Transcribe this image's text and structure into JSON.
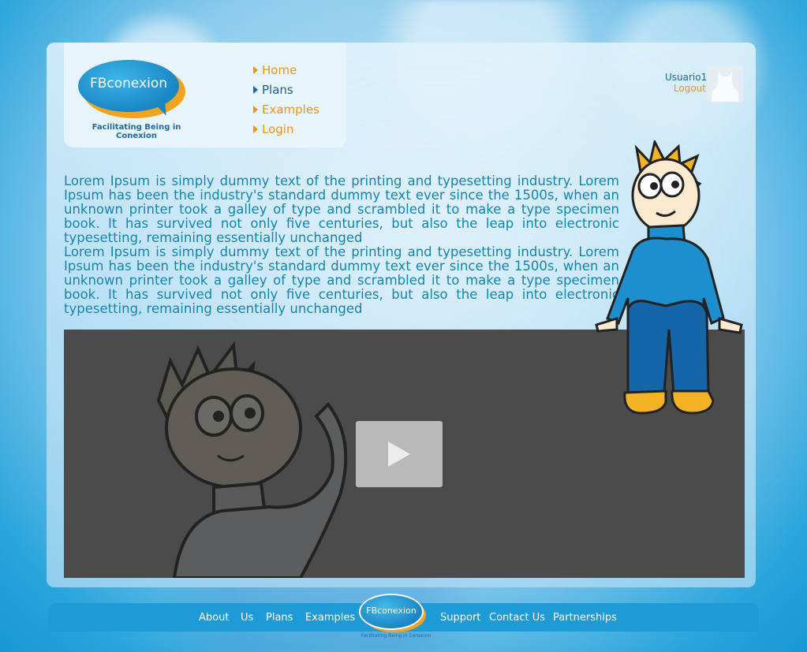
{
  "brand": {
    "name": "FBconexion",
    "tagline": "Facilitating Being in Conexion"
  },
  "nav": {
    "items": [
      {
        "label": "Home",
        "style": "orange"
      },
      {
        "label": "Plans",
        "style": "dark"
      },
      {
        "label": "Examples",
        "style": "orange"
      },
      {
        "label": "Login",
        "style": "orange"
      }
    ]
  },
  "user": {
    "name": "Usuario1",
    "logout": "Logout"
  },
  "content": {
    "paragraphs": [
      "Lorem Ipsum is simply dummy text of the printing and typesetting industry. Lorem Ipsum has been the industry's standard dummy text ever since the 1500s, when an unknown printer took a galley of type and scrambled it to make a type specimen book. It has survived not only five centuries, but also the leap into electronic typesetting, remaining essentially unchanged",
      "Lorem Ipsum is simply dummy text of the printing and typesetting industry. Lorem Ipsum has been the industry's standard dummy text ever since the 1500s, when an unknown printer took a galley of type and scrambled it to make a type specimen book. It has survived not only five centuries, but also the leap into electronic typesetting, remaining essentially unchanged"
    ]
  },
  "video": {
    "play_icon": "play-icon"
  },
  "footer": {
    "links": [
      "About",
      "Us",
      "Plans",
      "Examples",
      "Support",
      "Contact Us",
      "Partnerships"
    ],
    "logo_name": "FBconexion",
    "logo_tagline": "Facilitating Being in Conexion"
  },
  "colors": {
    "accent_orange": "#e8961c",
    "brand_blue": "#1a86c4",
    "text_blue": "#0e83b3",
    "footer_blue": "#1e9bd6",
    "video_bg": "#4b4b4b"
  }
}
